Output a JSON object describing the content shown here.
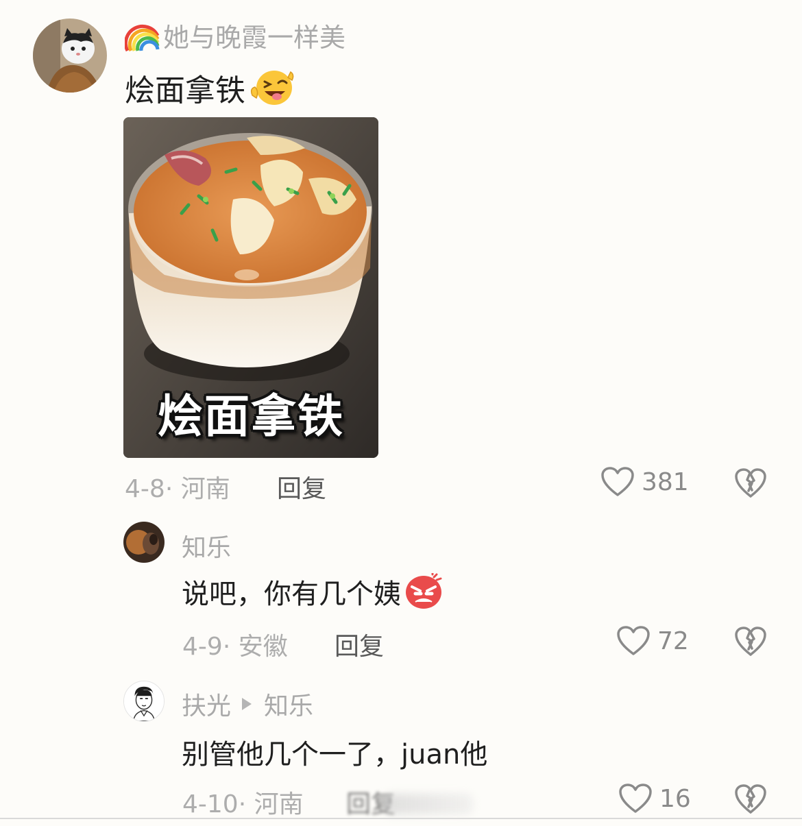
{
  "comments": [
    {
      "username": "她与晚霞一样美",
      "username_prefix_icon": "rainbow-emoji",
      "text": "烩面拿铁",
      "text_emoji": "winking-tongue-emoji",
      "image_caption": "烩面拿铁",
      "date": "4-8",
      "location": "河南",
      "reply_label": "回复",
      "likes": "381"
    },
    {
      "username": "知乐",
      "text": "说吧，你有几个姨",
      "text_emoji": "angry-face-emoji",
      "date": "4-9",
      "location": "安徽",
      "reply_label": "回复",
      "likes": "72"
    },
    {
      "username": "扶光",
      "reply_to": "知乐",
      "text": "别管他几个一了，juan他",
      "date": "4-10",
      "location": "河南",
      "reply_label": "回复",
      "likes": "16"
    }
  ],
  "meta_separator": "· ",
  "colors": {
    "background": "#fdfcf9",
    "username": "#a9a9a9",
    "text": "#1f1f1f",
    "meta": "#adadad",
    "reply": "#595959"
  }
}
